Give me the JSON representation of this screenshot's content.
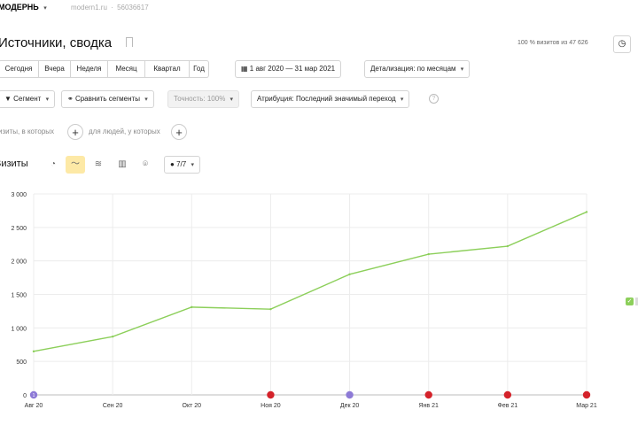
{
  "header": {
    "counter_name": "МОДЕРНЬ",
    "site": "modern1.ru",
    "counter_id": "56036617"
  },
  "page": {
    "title": "Источники, сводка",
    "visits_share": "100 % визитов из 47 626"
  },
  "periods": [
    "Сегодня",
    "Вчера",
    "Неделя",
    "Месяц",
    "Квартал",
    "Год"
  ],
  "toolbar": {
    "date_range": "1 авг 2020 — 31 мар 2021",
    "detail": "Детализация: по месяцам",
    "segment": "Сегмент",
    "compare": "Сравнить сегменты",
    "accuracy": "Точность: 100%",
    "attribution": "Атрибуция: Последний значимый переход"
  },
  "filters": {
    "visits_label": "изиты, в которых",
    "people_label": "для людей, у которых"
  },
  "chart_header": {
    "metric": "Визиты",
    "annotations": "7/7"
  },
  "legend": {
    "color": "#8ccf5a"
  },
  "chart_data": {
    "type": "line",
    "categories": [
      "Авг 20",
      "Сен 20",
      "Окт 20",
      "Ноя 20",
      "Дек 20",
      "Янв 21",
      "Фев 21",
      "Мар 21"
    ],
    "series": [
      {
        "values": [
          650,
          870,
          1310,
          1280,
          1800,
          2100,
          2220,
          2730
        ]
      }
    ],
    "yticks": [
      "3 000",
      "2 500",
      "2 000",
      "1 500",
      "1 000",
      "500",
      "0"
    ],
    "ylim": [
      0,
      3000
    ],
    "grid": true,
    "line_color": "#8ccf5a",
    "markers": [
      {
        "label": "Авг 20",
        "kind": "purple",
        "text": "1"
      },
      {
        "label": "Ноя 20",
        "kind": "red",
        "text": ""
      },
      {
        "label": "Дек 20",
        "kind": "purple",
        "text": ""
      },
      {
        "label": "Янв 21",
        "kind": "red",
        "text": ""
      },
      {
        "label": "Фев 21",
        "kind": "red",
        "text": ""
      },
      {
        "label": "Мар 21",
        "kind": "red",
        "text": ""
      }
    ]
  }
}
